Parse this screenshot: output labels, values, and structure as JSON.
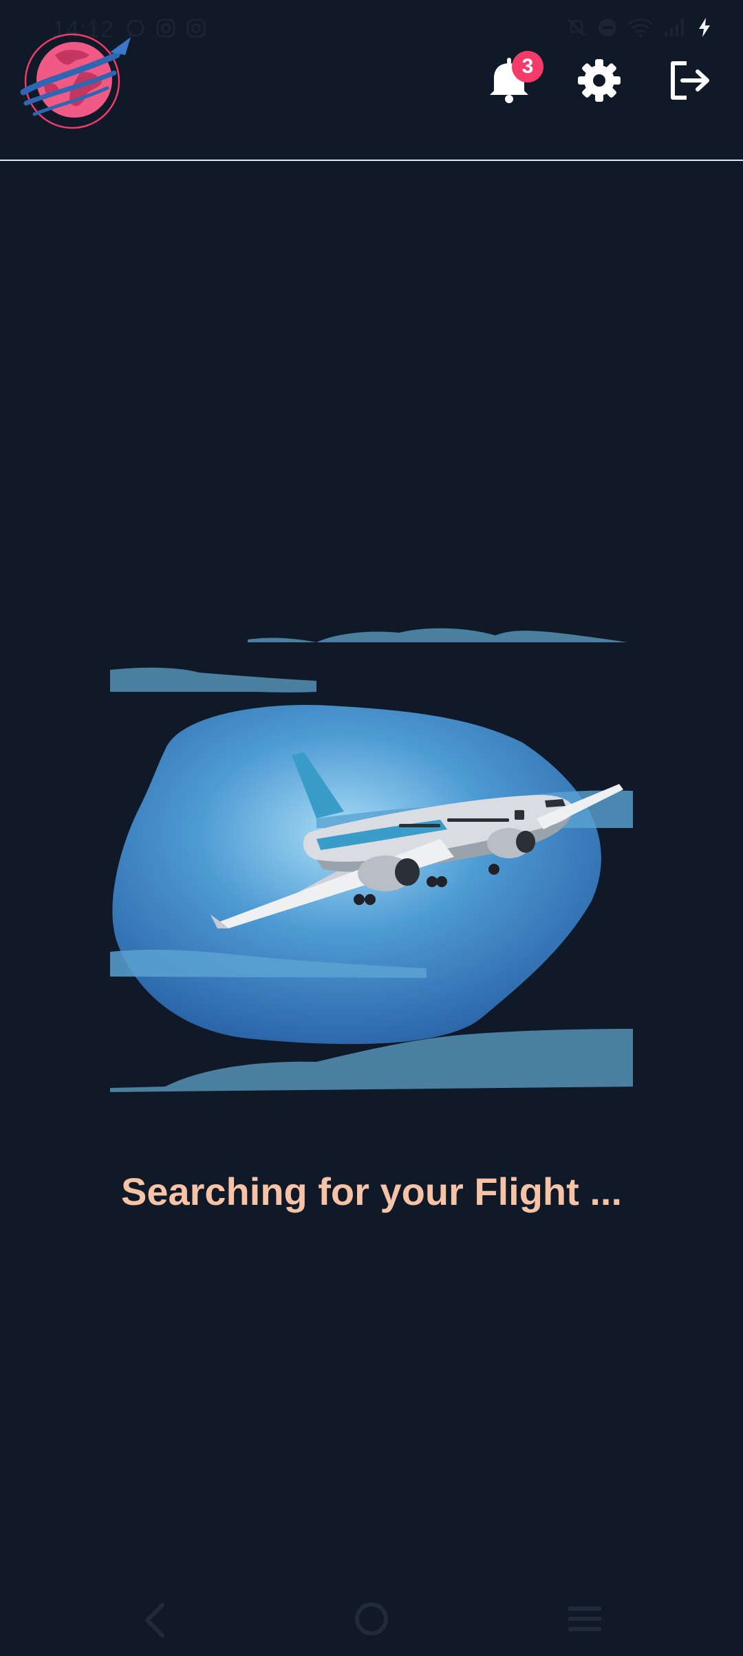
{
  "status_bar": {
    "time": "14:12",
    "left_icons": [
      "whatsapp-icon",
      "instagram-icon",
      "instagram-icon"
    ],
    "right_icons": [
      "bell-muted-icon",
      "dnd-icon",
      "wifi-icon",
      "signal-icon",
      "charging-icon"
    ]
  },
  "header": {
    "logo_icon": "globe-plane-logo",
    "notification_count": "3",
    "actions": [
      "notifications-icon",
      "settings-icon",
      "logout-icon"
    ]
  },
  "main": {
    "illustration_icon": "airplane-illustration",
    "status_text": "Searching for your Flight ..."
  },
  "nav_bar": {
    "buttons": [
      "back-icon",
      "home-icon",
      "recents-icon"
    ]
  },
  "colors": {
    "background": "#0f1928",
    "accent": "#f43b6a",
    "status_text": "#f6c3a6",
    "cloud": "#4b7fa0"
  }
}
